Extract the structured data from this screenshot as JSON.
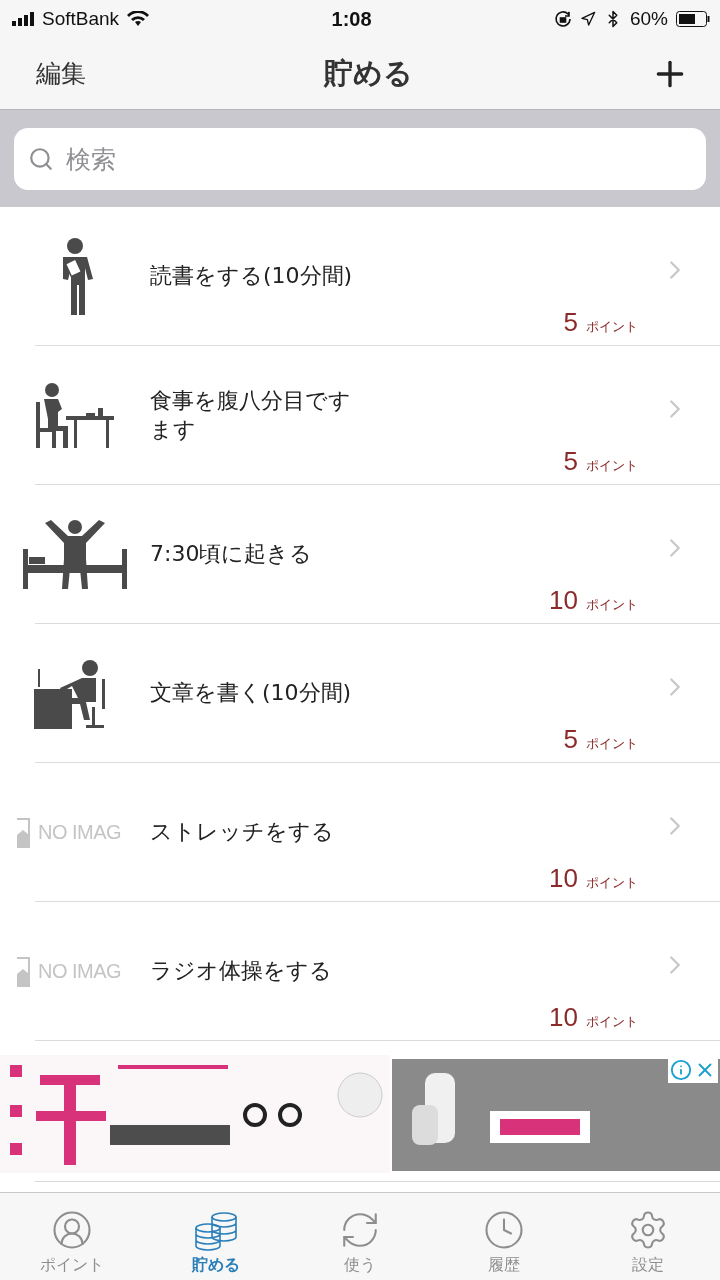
{
  "status_bar": {
    "carrier": "SoftBank",
    "time": "1:08",
    "battery": "60%"
  },
  "nav": {
    "left": "編集",
    "title": "貯める"
  },
  "search": {
    "placeholder": "検索"
  },
  "items": [
    {
      "kind": "reading",
      "title": "読書をする(10分間)",
      "points": "5",
      "unit": "ポイント"
    },
    {
      "kind": "eating",
      "title": "食事を腹八分目ですます",
      "points": "5",
      "unit": "ポイント"
    },
    {
      "kind": "waking",
      "title": "7:30頃に起きる",
      "points": "10",
      "unit": "ポイント"
    },
    {
      "kind": "writing",
      "title": "文章を書く(10分間)",
      "points": "5",
      "unit": "ポイント"
    },
    {
      "kind": "noimage",
      "noimage_text": "NO IMAG",
      "title": "ストレッチをする",
      "points": "10",
      "unit": "ポイント"
    },
    {
      "kind": "noimage",
      "noimage_text": "NO IMAG",
      "title": "ラジオ体操をする",
      "points": "10",
      "unit": "ポイント"
    }
  ],
  "tabs": [
    {
      "kind": "person",
      "label": "ポイント",
      "selected": false
    },
    {
      "kind": "coins",
      "label": "貯める",
      "selected": true
    },
    {
      "kind": "refresh",
      "label": "使う",
      "selected": false
    },
    {
      "kind": "clock",
      "label": "履歴",
      "selected": false
    },
    {
      "kind": "gear",
      "label": "設定",
      "selected": false
    }
  ]
}
